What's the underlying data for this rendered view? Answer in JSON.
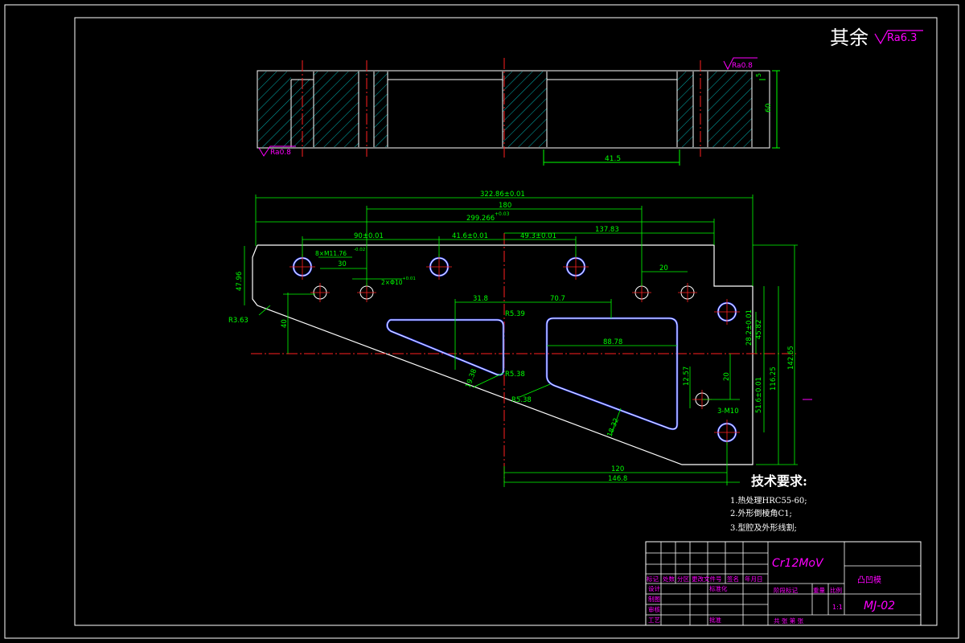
{
  "surface_finish": {
    "remark_text": "其余",
    "remark_value": "Ra6.3",
    "top_right": "Ra0.8",
    "bottom_left": "Ra0.8"
  },
  "section_view": {
    "dim_width": "41.5",
    "dim_height": "60",
    "dim_small": "5"
  },
  "plan_view": {
    "dim_overall": "322.86±0.01",
    "dim_180_top": "180",
    "dim_299": "299.266",
    "dim_299_tol": "+0.03",
    "dim_90": "90±0.01",
    "dim_41_6": "41.6±0.01",
    "dim_49_3": "49.3±0.01",
    "dim_137": "137.83",
    "dim_30": "30",
    "dim_20_top": "20",
    "dim_thread": "8×M11.76",
    "dim_thread_tol": "-0.02",
    "dim_pin": "2×Φ10",
    "dim_pin_tol": "+0.01",
    "dim_47": "47.96",
    "dim_r3": "R3.63",
    "dim_40": "40",
    "dim_31_8": "31.8",
    "dim_70_7": "70.7",
    "dim_r5_39": "R5.39",
    "dim_88_78": "88.78",
    "dim_r5_38a": "R5.38",
    "dim_r5_38b": "R5.38",
    "dim_19_38": "19.38",
    "dim_18_32": "18.32",
    "dim_12_57": "12.57",
    "dim_20_right": "20",
    "dim_3m10": "3-M10",
    "dim_28_2": "28.2±0.01",
    "dim_45_82": "45.82",
    "dim_51_6": "51.6±0.01",
    "dim_116": "116.25",
    "dim_142": "142.65",
    "dim_120": "120",
    "dim_146_8": "146.8"
  },
  "requirements": {
    "title": "技术要求:",
    "items": [
      "1.热处理HRC55-60;",
      "2.外形倒棱角C1;",
      "3.型腔及外形线割;"
    ]
  },
  "title_block": {
    "material": "Cr12MoV",
    "part_name": "凸凹模",
    "drawing_no": "MJ-02",
    "scale": "1:1",
    "row_headers": [
      "标记",
      "处数",
      "分区",
      "更改文件号",
      "签名",
      "年月日"
    ],
    "labels": {
      "design": "设计",
      "standard": "标准化",
      "check": "审核",
      "process": "工艺",
      "approve": "批准",
      "draw": "制图",
      "stage": "阶段标记",
      "weight": "重量",
      "ratio": "比例",
      "sheets": "共    张  第    张"
    }
  },
  "colors": {
    "background": "#000000",
    "outline": "#ffffff",
    "dimension": "#00ff00",
    "centerline": "#ff0000",
    "hatch": "#00ffff",
    "annotation": "#ff00ff",
    "hole": "#0000ff"
  }
}
